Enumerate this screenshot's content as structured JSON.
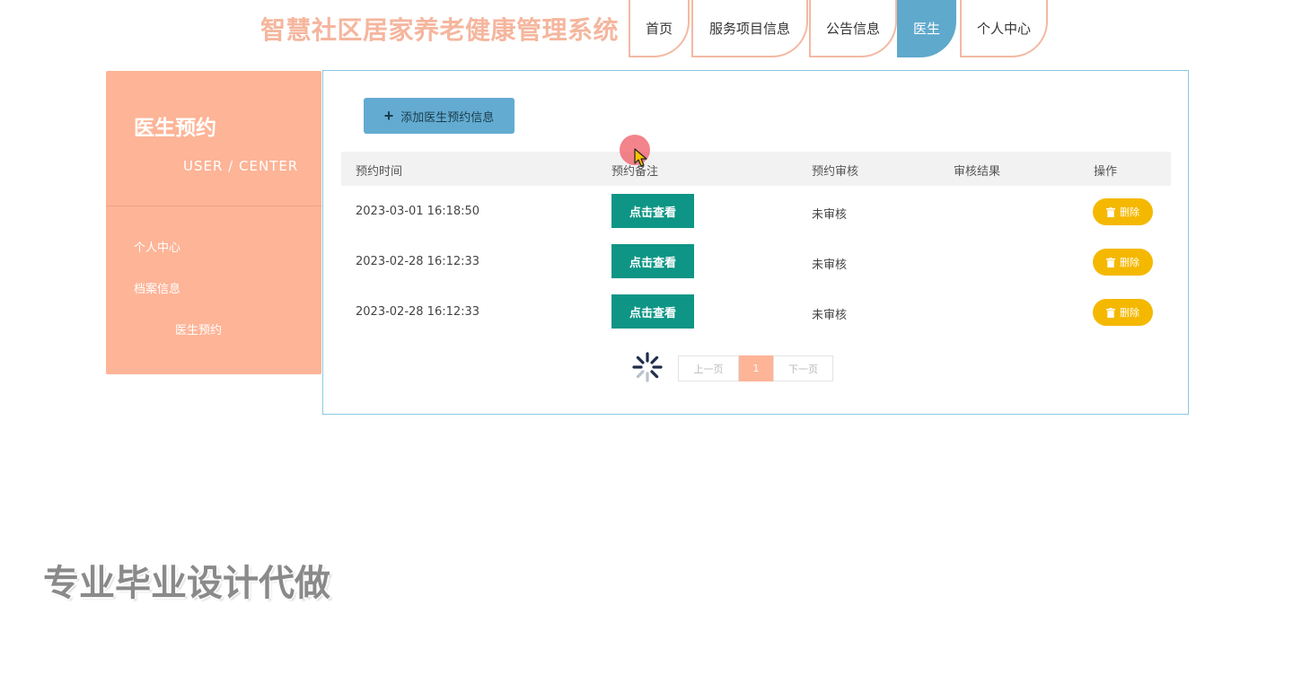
{
  "header": {
    "title": "智慧社区居家养老健康管理系统",
    "nav": [
      {
        "label": "首页"
      },
      {
        "label": "服务项目信息"
      },
      {
        "label": "公告信息"
      },
      {
        "label": "医生",
        "active": true
      },
      {
        "label": "个人中心"
      }
    ]
  },
  "sidebar": {
    "title": "医生预约",
    "subtitle": "USER / CENTER",
    "items": [
      {
        "label": "个人中心"
      },
      {
        "label": "档案信息"
      },
      {
        "label": "医生预约"
      }
    ]
  },
  "main": {
    "add_button_label": "添加医生预约信息",
    "table": {
      "headers": [
        "预约时间",
        "预约备注",
        "预约审核",
        "审核结果",
        "操作"
      ],
      "rows": [
        {
          "time": "2023-03-01 16:18:50",
          "note_button": "点击查看",
          "audit": "未审核",
          "result": "",
          "action": "删除"
        },
        {
          "time": "2023-02-28 16:12:33",
          "note_button": "点击查看",
          "audit": "未审核",
          "result": "",
          "action": "删除"
        },
        {
          "time": "2023-02-28 16:12:33",
          "note_button": "点击查看",
          "audit": "未审核",
          "result": "",
          "action": "删除"
        }
      ]
    },
    "pagination": {
      "prev": "上一页",
      "current": "1",
      "next": "下一页"
    }
  },
  "watermark": "专业毕业设计代做",
  "colors": {
    "accent_salmon": "#fdb497",
    "nav_active": "#5fa9cc",
    "view_button": "#0e9585",
    "delete_button": "#f5b800"
  }
}
